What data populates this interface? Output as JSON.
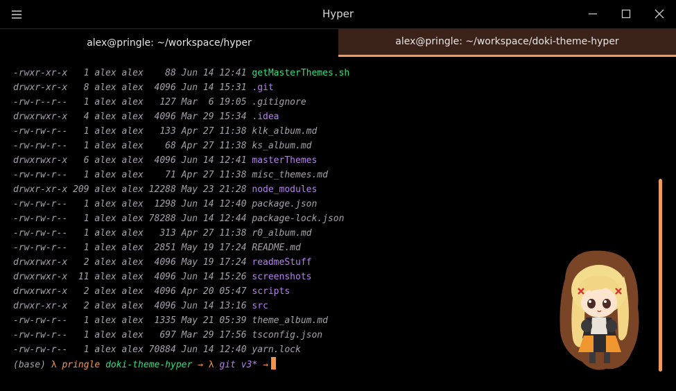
{
  "window": {
    "title": "Hyper"
  },
  "tabs": [
    {
      "label": "alex@pringle: ~/workspace/hyper",
      "active": false
    },
    {
      "label": "alex@pringle: ~/workspace/doki-theme-hyper",
      "active": true
    }
  ],
  "listing": [
    {
      "perms": "-rwxr-xr-x",
      "links": "  1",
      "owner": "alex",
      "group": "alex",
      "size": "   88",
      "date": "Jun 14 12:41",
      "name": "getMasterThemes.sh",
      "kind": "exec"
    },
    {
      "perms": "drwxr-xr-x",
      "links": "  8",
      "owner": "alex",
      "group": "alex",
      "size": " 4096",
      "date": "Jun 14 15:31",
      "name": ".git",
      "kind": "dir"
    },
    {
      "perms": "-rw-r--r--",
      "links": "  1",
      "owner": "alex",
      "group": "alex",
      "size": "  127",
      "date": "Mar  6 19:05",
      "name": ".gitignore",
      "kind": "file"
    },
    {
      "perms": "drwxrwxr-x",
      "links": "  4",
      "owner": "alex",
      "group": "alex",
      "size": " 4096",
      "date": "Mar 29 15:34",
      "name": ".idea",
      "kind": "dir"
    },
    {
      "perms": "-rw-rw-r--",
      "links": "  1",
      "owner": "alex",
      "group": "alex",
      "size": "  133",
      "date": "Apr 27 11:38",
      "name": "klk_album.md",
      "kind": "file"
    },
    {
      "perms": "-rw-rw-r--",
      "links": "  1",
      "owner": "alex",
      "group": "alex",
      "size": "   68",
      "date": "Apr 27 11:38",
      "name": "ks_album.md",
      "kind": "file"
    },
    {
      "perms": "drwxrwxr-x",
      "links": "  6",
      "owner": "alex",
      "group": "alex",
      "size": " 4096",
      "date": "Jun 14 12:41",
      "name": "masterThemes",
      "kind": "dir"
    },
    {
      "perms": "-rw-rw-r--",
      "links": "  1",
      "owner": "alex",
      "group": "alex",
      "size": "   71",
      "date": "Apr 27 11:38",
      "name": "misc_themes.md",
      "kind": "file"
    },
    {
      "perms": "drwxr-xr-x",
      "links": "209",
      "owner": "alex",
      "group": "alex",
      "size": "12288",
      "date": "May 23 21:28",
      "name": "node_modules",
      "kind": "dir"
    },
    {
      "perms": "-rw-rw-r--",
      "links": "  1",
      "owner": "alex",
      "group": "alex",
      "size": " 1298",
      "date": "Jun 14 12:40",
      "name": "package.json",
      "kind": "file"
    },
    {
      "perms": "-rw-rw-r--",
      "links": "  1",
      "owner": "alex",
      "group": "alex",
      "size": "78288",
      "date": "Jun 14 12:44",
      "name": "package-lock.json",
      "kind": "file"
    },
    {
      "perms": "-rw-rw-r--",
      "links": "  1",
      "owner": "alex",
      "group": "alex",
      "size": "  313",
      "date": "Apr 27 11:38",
      "name": "r0_album.md",
      "kind": "file"
    },
    {
      "perms": "-rw-rw-r--",
      "links": "  1",
      "owner": "alex",
      "group": "alex",
      "size": " 2851",
      "date": "May 19 17:24",
      "name": "README.md",
      "kind": "file"
    },
    {
      "perms": "drwxrwxr-x",
      "links": "  2",
      "owner": "alex",
      "group": "alex",
      "size": " 4096",
      "date": "May 19 17:24",
      "name": "readmeStuff",
      "kind": "dir"
    },
    {
      "perms": "drwxrwxr-x",
      "links": " 11",
      "owner": "alex",
      "group": "alex",
      "size": " 4096",
      "date": "Jun 14 15:26",
      "name": "screenshots",
      "kind": "dir"
    },
    {
      "perms": "drwxrwxr-x",
      "links": "  2",
      "owner": "alex",
      "group": "alex",
      "size": " 4096",
      "date": "Apr 20 05:47",
      "name": "scripts",
      "kind": "dir"
    },
    {
      "perms": "drwxr-xr-x",
      "links": "  2",
      "owner": "alex",
      "group": "alex",
      "size": " 4096",
      "date": "Jun 14 13:16",
      "name": "src",
      "kind": "dir"
    },
    {
      "perms": "-rw-rw-r--",
      "links": "  1",
      "owner": "alex",
      "group": "alex",
      "size": " 1335",
      "date": "May 21 05:39",
      "name": "theme_album.md",
      "kind": "file"
    },
    {
      "perms": "-rw-rw-r--",
      "links": "  1",
      "owner": "alex",
      "group": "alex",
      "size": "  697",
      "date": "Mar 29 17:56",
      "name": "tsconfig.json",
      "kind": "file"
    },
    {
      "perms": "-rw-rw-r--",
      "links": "  1",
      "owner": "alex",
      "group": "alex",
      "size": "70884",
      "date": "Jun 14 12:40",
      "name": "yarn.lock",
      "kind": "file"
    }
  ],
  "prompt": {
    "env": "(base)",
    "lambda1": "λ",
    "host": "pringle",
    "dir": "doki-theme-hyper",
    "arrow1": "→",
    "lambda2": "λ",
    "git": "git v3*",
    "arrow2": "→"
  },
  "colors": {
    "accent": "#f39b5e",
    "exec": "#2de07f",
    "dir": "#b580ee",
    "file": "#a6a0aa",
    "tab_active_bg": "#3b2219"
  },
  "icons": {
    "menu": "hamburger-menu-icon",
    "minimize": "minimize-icon",
    "maximize": "maximize-icon",
    "close": "close-icon"
  }
}
